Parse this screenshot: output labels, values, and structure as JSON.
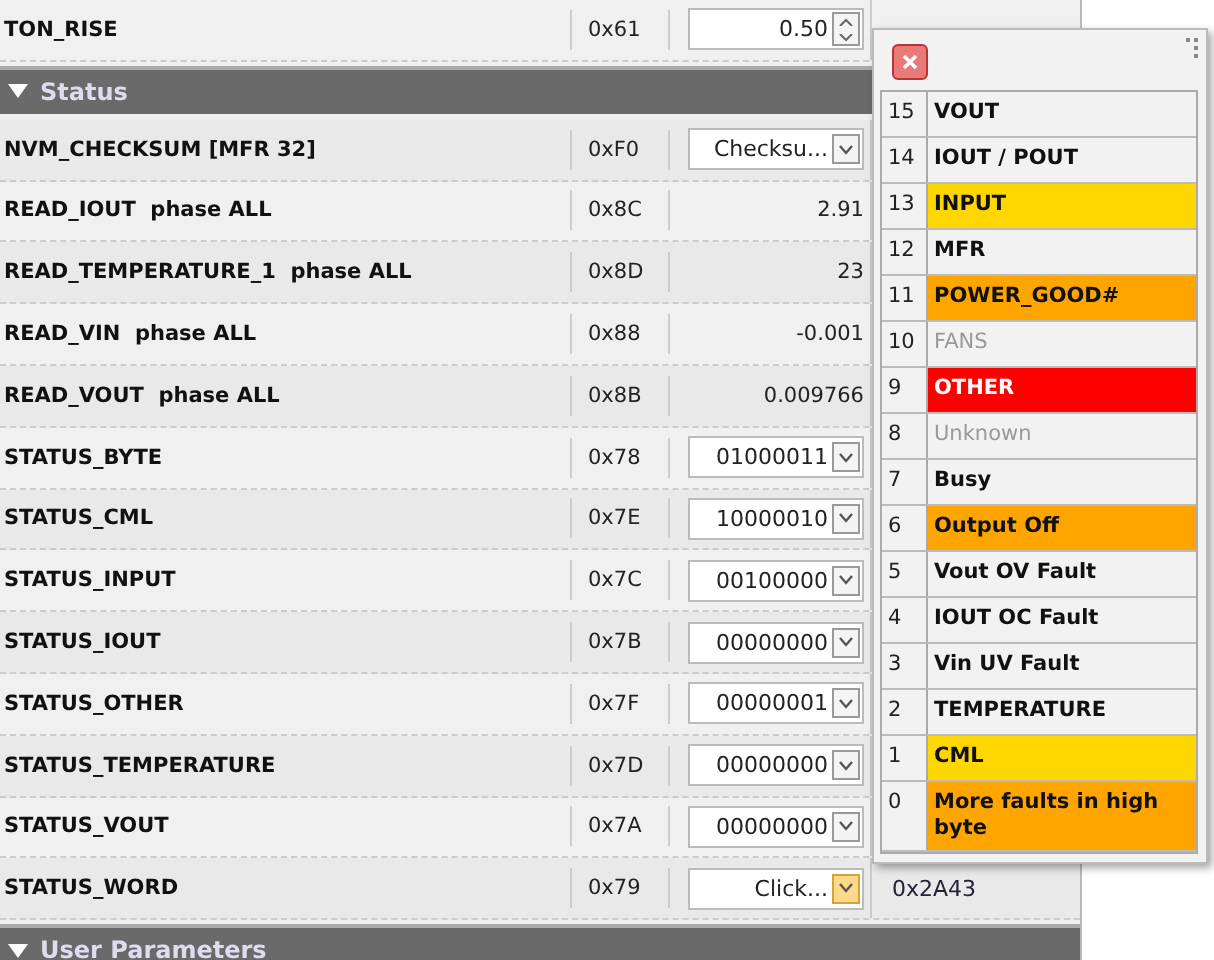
{
  "rows": [
    {
      "kind": "register",
      "name": "TON_RISE",
      "address": "0x61",
      "value": {
        "kind": "spinner",
        "text": "0.50"
      }
    },
    {
      "kind": "section",
      "title": "Status",
      "expanded": true
    },
    {
      "kind": "register",
      "name": "NVM_CHECKSUM [MFR 32]",
      "address": "0xF0",
      "value": {
        "kind": "dropdown",
        "text": "Checksu...",
        "expanded": false
      }
    },
    {
      "kind": "register",
      "name": "READ_IOUT  phase ALL",
      "address": "0x8C",
      "value": {
        "kind": "readout",
        "text": "2.91"
      }
    },
    {
      "kind": "register",
      "name": "READ_TEMPERATURE_1  phase ALL",
      "address": "0x8D",
      "value": {
        "kind": "readout",
        "text": "23"
      }
    },
    {
      "kind": "register",
      "name": "READ_VIN  phase ALL",
      "address": "0x88",
      "value": {
        "kind": "readout",
        "text": "-0.001"
      }
    },
    {
      "kind": "register",
      "name": "READ_VOUT  phase ALL",
      "address": "0x8B",
      "value": {
        "kind": "readout",
        "text": "0.009766"
      }
    },
    {
      "kind": "register",
      "name": "STATUS_BYTE",
      "address": "0x78",
      "value": {
        "kind": "dropdown",
        "text": "01000011",
        "expanded": false
      }
    },
    {
      "kind": "register",
      "name": "STATUS_CML",
      "address": "0x7E",
      "value": {
        "kind": "dropdown",
        "text": "10000010",
        "expanded": false
      }
    },
    {
      "kind": "register",
      "name": "STATUS_INPUT",
      "address": "0x7C",
      "value": {
        "kind": "dropdown",
        "text": "00100000",
        "expanded": false
      }
    },
    {
      "kind": "register",
      "name": "STATUS_IOUT",
      "address": "0x7B",
      "value": {
        "kind": "dropdown",
        "text": "00000000",
        "expanded": false
      }
    },
    {
      "kind": "register",
      "name": "STATUS_OTHER",
      "address": "0x7F",
      "value": {
        "kind": "dropdown",
        "text": "00000001",
        "expanded": false
      }
    },
    {
      "kind": "register",
      "name": "STATUS_TEMPERATURE",
      "address": "0x7D",
      "value": {
        "kind": "dropdown",
        "text": "00000000",
        "expanded": false
      }
    },
    {
      "kind": "register",
      "name": "STATUS_VOUT",
      "address": "0x7A",
      "value": {
        "kind": "dropdown",
        "text": "00000000",
        "expanded": false
      }
    },
    {
      "kind": "register",
      "name": "STATUS_WORD",
      "address": "0x79",
      "value": {
        "kind": "dropdown",
        "text": "Click...",
        "expanded": true
      },
      "column_4": "0x2A43"
    },
    {
      "kind": "section",
      "title": "User Parameters",
      "expanded": true
    }
  ],
  "bits_popup": {
    "bits": [
      {
        "bit": "15",
        "label": "VOUT",
        "disabled": false
      },
      {
        "bit": "14",
        "label": "IOUT / POUT",
        "disabled": false
      },
      {
        "bit": "13",
        "label": "INPUT",
        "disabled": false,
        "color": "#ffd700"
      },
      {
        "bit": "12",
        "label": "MFR",
        "disabled": false
      },
      {
        "bit": "11",
        "label": "POWER_GOOD#",
        "disabled": false,
        "color": "#ffa500"
      },
      {
        "bit": "10",
        "label": "FANS",
        "disabled": true
      },
      {
        "bit": "9",
        "label": "OTHER",
        "disabled": false,
        "color": "#ff0000"
      },
      {
        "bit": "8",
        "label": "Unknown",
        "disabled": true
      },
      {
        "bit": "7",
        "label": "Busy",
        "disabled": false
      },
      {
        "bit": "6",
        "label": "Output Off",
        "disabled": false,
        "color": "#ffa500"
      },
      {
        "bit": "5",
        "label": "Vout OV Fault",
        "disabled": false
      },
      {
        "bit": "4",
        "label": "IOUT OC Fault",
        "disabled": false
      },
      {
        "bit": "3",
        "label": "Vin UV Fault",
        "disabled": false
      },
      {
        "bit": "2",
        "label": "TEMPERATURE",
        "disabled": false
      },
      {
        "bit": "1",
        "label": "CML",
        "disabled": false,
        "color": "#ffd700"
      },
      {
        "bit": "0",
        "label": "More faults in high byte",
        "disabled": false,
        "color": "#ffa500"
      }
    ]
  }
}
